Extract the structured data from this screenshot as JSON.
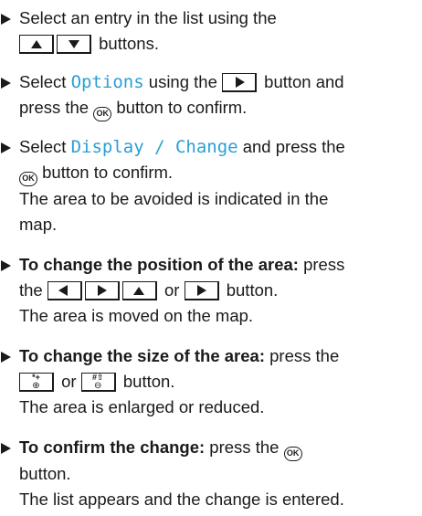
{
  "steps": [
    {
      "line1": "Select an entry in the list using the",
      "line2_after": "buttons."
    },
    {
      "pre": "Select ",
      "menu": "Options",
      "mid": " using the ",
      "post": " button and",
      "line2_pre": "press the ",
      "line2_post": " button to confirm."
    },
    {
      "pre": "Select ",
      "menu": "Display / Change",
      "post": " and press the",
      "line2_post": " button to confirm.",
      "result1": "The area to be avoided is indicated in the",
      "result2": "map."
    },
    {
      "bold": "To change the position of the area:",
      "post": " press",
      "line2_pre": "the ",
      "line2_or": " or ",
      "line2_post": " button.",
      "result": "The area is moved on the map."
    },
    {
      "bold": "To change the size of the area:",
      "post": " press the",
      "line2_or": " or ",
      "line2_post": " button.",
      "result": "The area is enlarged or reduced."
    },
    {
      "bold": "To confirm the change:",
      "post": " press the ",
      "line2": "button.",
      "result": "The list appears and the change is entered."
    }
  ],
  "keys": {
    "ok": "OK",
    "zoom_in_top": "*+",
    "zoom_in_bottom": "⊕",
    "zoom_out_top": "#⇧",
    "zoom_out_bottom": "⊖"
  },
  "icons": [
    "triangle-bullet-icon",
    "up-arrow-icon",
    "down-arrow-icon",
    "left-arrow-icon",
    "right-arrow-icon",
    "ok-button-icon",
    "zoom-in-key-icon",
    "zoom-out-key-icon"
  ],
  "colors": {
    "text": "#1a1a1a",
    "menu_item": "#2a9fd6"
  }
}
